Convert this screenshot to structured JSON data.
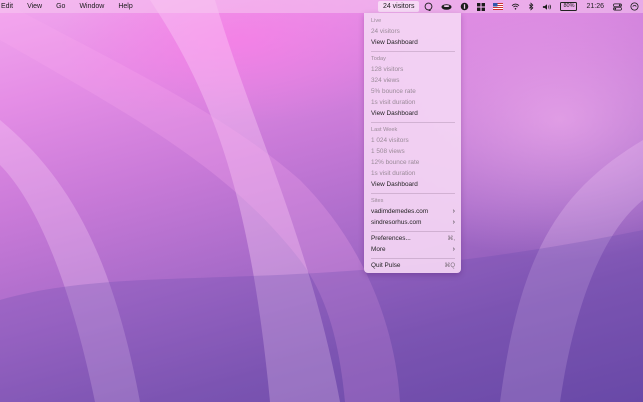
{
  "menubar": {
    "menus": [
      "Edit",
      "View",
      "Go",
      "Window",
      "Help"
    ],
    "status": {
      "visitors_label": "24 visitors",
      "battery": "80%",
      "clock": "21:26"
    },
    "icons": [
      "pulse-icon",
      "coffee-icon",
      "onepassword-icon",
      "grid-icon",
      "flag-icon",
      "wifi-icon",
      "bluetooth-icon",
      "volume-icon",
      "battery-icon",
      "control-center-icon",
      "siri-icon"
    ]
  },
  "dropdown": {
    "live": {
      "header": "Live",
      "visitors": "24 visitors",
      "dashboard": "View Dashboard"
    },
    "today": {
      "header": "Today",
      "visitors": "128 visitors",
      "views": "324 views",
      "bounce": "5% bounce rate",
      "duration": "1s visit duration",
      "dashboard": "View Dashboard"
    },
    "last_week": {
      "header": "Last Week",
      "visitors": "1 024 visitors",
      "views": "1 508 views",
      "bounce": "12% bounce rate",
      "duration": "1s visit duration",
      "dashboard": "View Dashboard"
    },
    "sites": {
      "header": "Sites",
      "items": [
        "vadimdemedes.com",
        "sindresorhus.com"
      ]
    },
    "preferences": {
      "label": "Preferences...",
      "shortcut": "⌘,"
    },
    "more": {
      "label": "More"
    },
    "quit": {
      "label": "Quit Pulse",
      "shortcut": "⌘Q"
    }
  }
}
